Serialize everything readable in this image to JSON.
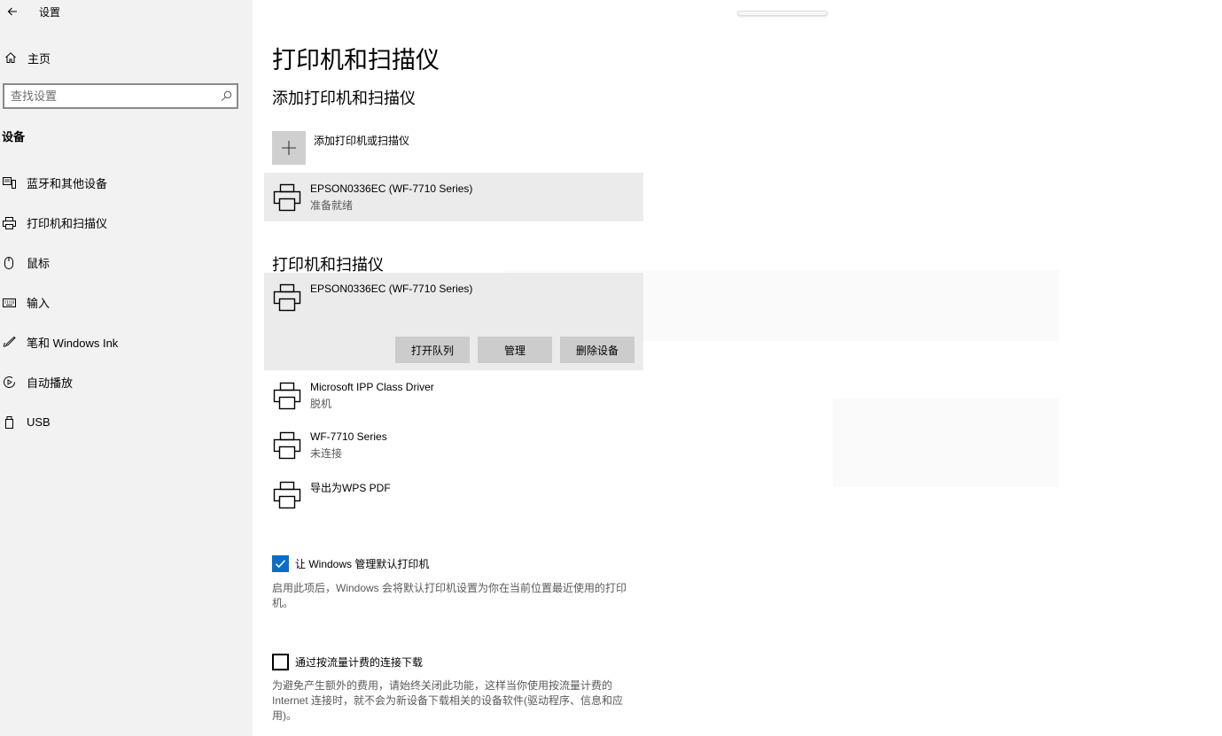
{
  "window": {
    "title": "设置"
  },
  "sidebar": {
    "home_label": "主页",
    "search_placeholder": "查找设置",
    "section_label": "设备",
    "items": [
      {
        "label": "蓝牙和其他设备",
        "icon": "bluetooth-devices-icon"
      },
      {
        "label": "打印机和扫描仪",
        "icon": "printer-icon"
      },
      {
        "label": "鼠标",
        "icon": "mouse-icon"
      },
      {
        "label": "输入",
        "icon": "keyboard-icon"
      },
      {
        "label": "笔和 Windows Ink",
        "icon": "pen-icon"
      },
      {
        "label": "自动播放",
        "icon": "autoplay-icon"
      },
      {
        "label": "USB",
        "icon": "usb-icon"
      }
    ]
  },
  "main": {
    "page_title": "打印机和扫描仪",
    "add_section_title": "添加打印机和扫描仪",
    "add_button_label": "添加打印机或扫描仪",
    "found_printer": {
      "name": "EPSON0336EC (WF-7710 Series)",
      "status": "准备就绪"
    },
    "list_section_title": "打印机和扫描仪",
    "selected_printer": {
      "name": "EPSON0336EC (WF-7710 Series)",
      "buttons": {
        "open_queue": "打开队列",
        "manage": "管理",
        "remove": "删除设备"
      }
    },
    "printers": [
      {
        "name": "Microsoft IPP Class Driver",
        "status": "脱机"
      },
      {
        "name": "WF-7710 Series",
        "status": "未连接"
      },
      {
        "name": "导出为WPS PDF",
        "status": ""
      }
    ],
    "default_printer": {
      "label": "让 Windows 管理默认打印机",
      "checked": true,
      "description": "启用此项后，Windows 会将默认打印机设置为你在当前位置最近使用的打印机。"
    },
    "metered_download": {
      "label": "通过按流量计费的连接下载",
      "checked": false,
      "description": "为避免产生额外的费用，请始终关闭此功能，这样当你使用按流量计费的 Internet 连接时，就不会为新设备下载相关的设备软件(驱动程序、信息和应用)。"
    }
  },
  "colors": {
    "accent": "#0a6ec8",
    "sidebar_bg": "#f2f2f2",
    "tile_selected": "#ebebeb",
    "button_bg": "#cccccc"
  }
}
